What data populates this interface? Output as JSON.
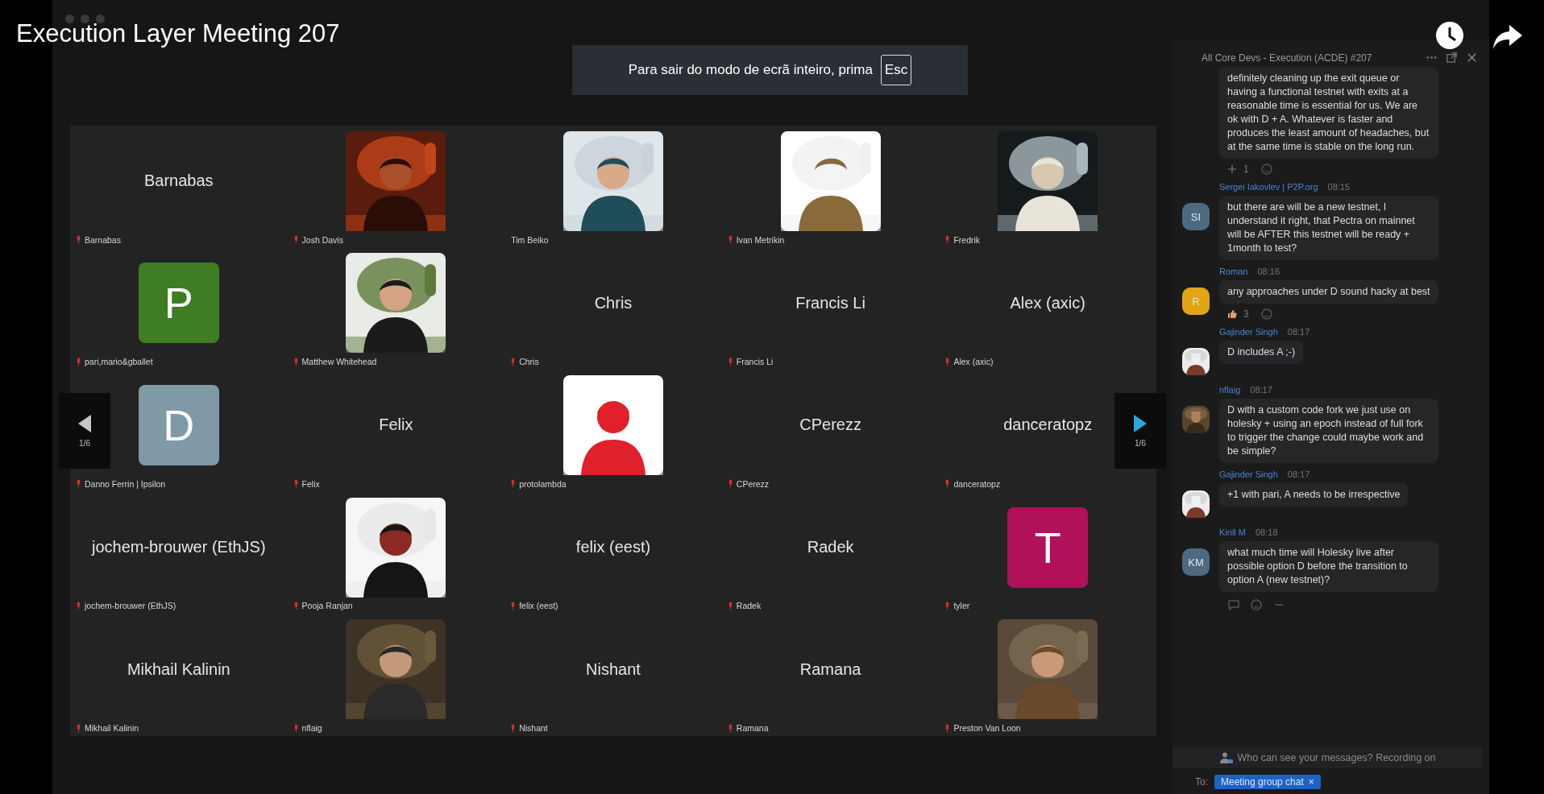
{
  "video_title": "Execution Layer Meeting 207",
  "fullscreen_notice": {
    "text": "Para sair do modo de ecrã inteiro, prima",
    "key": "Esc"
  },
  "pager": {
    "previous": "1/6",
    "next": "1/6"
  },
  "participants": [
    {
      "name": "Barnabas",
      "kind": "name",
      "display_name": "Barnabas",
      "muted": true
    },
    {
      "name": "Josh Davis",
      "kind": "picture",
      "muted": true
    },
    {
      "name": "Tim Beiko",
      "kind": "picture",
      "muted": false
    },
    {
      "name": "Ivan Metrikin",
      "kind": "picture",
      "muted": true
    },
    {
      "name": "Fredrik",
      "kind": "picture",
      "muted": true
    },
    {
      "name": "pari,mario&gballet",
      "kind": "letter",
      "letter": "P",
      "color": "#3e7d24",
      "muted": true
    },
    {
      "name": "Matthew Whitehead",
      "kind": "picture",
      "muted": true
    },
    {
      "name": "Chris",
      "kind": "name",
      "display_name": "Chris",
      "muted": true
    },
    {
      "name": "Francis Li",
      "kind": "name",
      "display_name": "Francis Li",
      "muted": true
    },
    {
      "name": "Alex (axic)",
      "kind": "name",
      "display_name": "Alex (axic)",
      "muted": true
    },
    {
      "name": "Danno Ferrin | Ipsilon",
      "kind": "letter",
      "letter": "D",
      "color": "#7f99a6",
      "muted": true
    },
    {
      "name": "Felix",
      "kind": "name",
      "display_name": "Felix",
      "muted": true
    },
    {
      "name": "protolambda",
      "kind": "picture",
      "muted": true
    },
    {
      "name": "CPerezz",
      "kind": "name",
      "display_name": "CPerezz",
      "muted": true
    },
    {
      "name": "danceratopz",
      "kind": "name",
      "display_name": "danceratopz",
      "muted": true
    },
    {
      "name": "jochem-brouwer (EthJS)",
      "kind": "name",
      "display_name": "jochem-brouwer (EthJS)",
      "muted": true
    },
    {
      "name": "Pooja Ranjan",
      "kind": "picture",
      "muted": true
    },
    {
      "name": "felix (eest)",
      "kind": "name",
      "display_name": "felix (eest)",
      "muted": true
    },
    {
      "name": "Radek",
      "kind": "name",
      "display_name": "Radek",
      "muted": true
    },
    {
      "name": "tyler",
      "kind": "letter",
      "letter": "T",
      "color": "#b0115a",
      "muted": true
    },
    {
      "name": "Mikhail Kalinin",
      "kind": "name",
      "display_name": "Mikhail Kalinin",
      "muted": true
    },
    {
      "name": "nflaig",
      "kind": "picture",
      "muted": true
    },
    {
      "name": "Nishant",
      "kind": "name",
      "display_name": "Nishant",
      "muted": true
    },
    {
      "name": "Ramana",
      "kind": "name",
      "display_name": "Ramana",
      "muted": true
    },
    {
      "name": "Preston Van Loon",
      "kind": "picture",
      "muted": true
    }
  ],
  "chat": {
    "title": "All Core Devs - Execution (ACDE) #207",
    "messages": [
      {
        "text": "definitely cleaning up the exit queue or having a functional testnet with exits at a reasonable time is essential for us. We are ok with D + A. Whatever is faster and produces the least amount of headaches, but at the same time is stable on the long run.",
        "reaction": {
          "kind": "plus",
          "count": "1"
        }
      },
      {
        "sender": "Sergei Iakovlev | P2P.org",
        "time": "08:15",
        "avatar": {
          "kind": "initials",
          "initials": "SI",
          "color": "#4d6a80"
        },
        "text": "but there are will be a new testnet, I understand it right, that Pectra on mainnet will be AFTER this testnet will be ready + 1month to test?"
      },
      {
        "sender": "Roman",
        "time": "08:16",
        "avatar": {
          "kind": "initials",
          "initials": "R",
          "color": "#e3a514"
        },
        "text": "any approaches under D sound hacky at best",
        "reaction": {
          "kind": "thumbs",
          "count": "3"
        }
      },
      {
        "sender": "Gajinder Singh",
        "time": "08:17",
        "text": "D includes A ;-)"
      },
      {
        "sender": "nflaig",
        "time": "08:17",
        "text": "D with a custom code fork we just use on holesky + using an epoch instead of full fork to trigger the change could maybe work and be simple?"
      },
      {
        "sender": "Gajinder Singh",
        "time": "08:17",
        "text": "+1 with pari, A needs to be irrespective"
      },
      {
        "sender": "Kirill M",
        "time": "08:18",
        "avatar": {
          "kind": "initials",
          "initials": "KM",
          "color": "#4d6a80"
        },
        "text": "what much time will Holesky live after possible option D before the transition to option A (new testnet)?"
      }
    ],
    "notice": "Who can see your messages? Recording on",
    "to_label": "To:",
    "recipient": "Meeting group chat",
    "recipient_remove": "×"
  }
}
